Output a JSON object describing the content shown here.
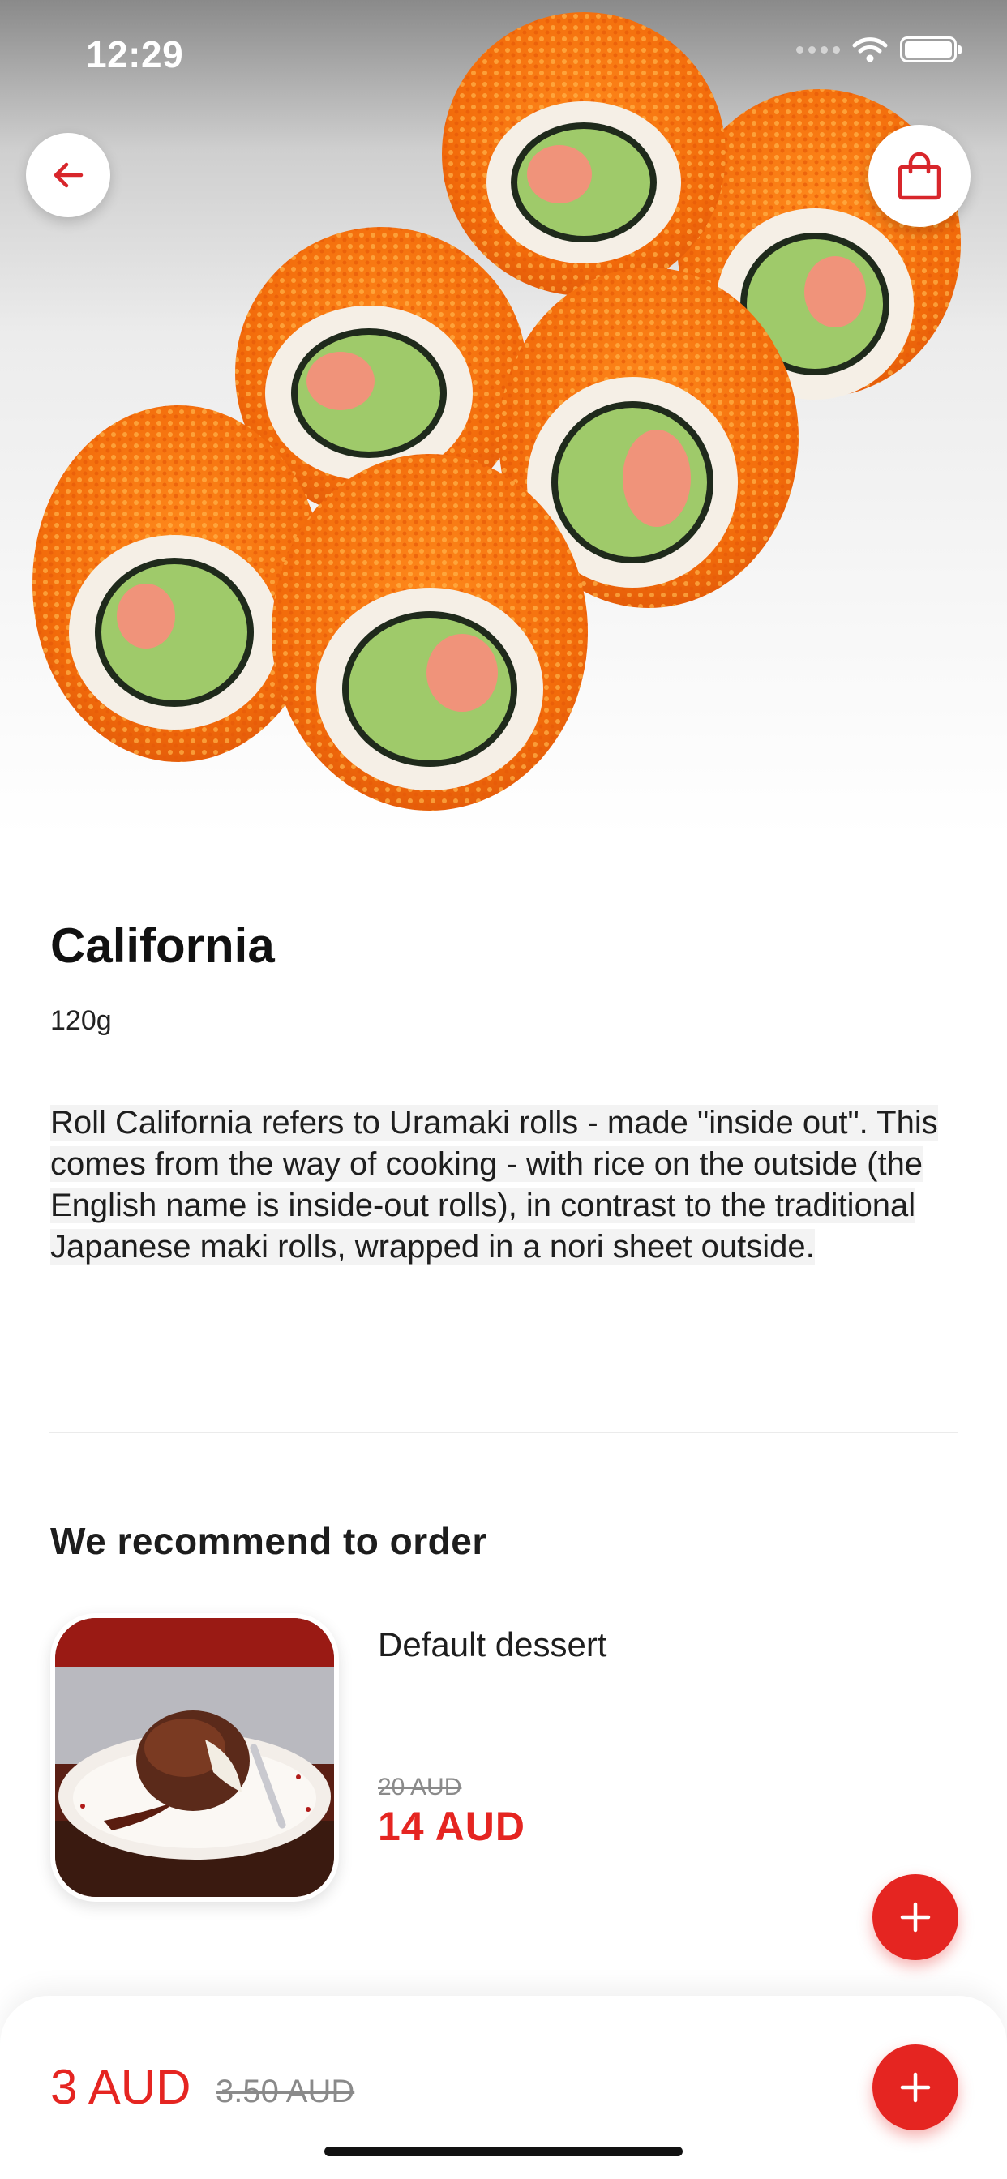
{
  "status_bar": {
    "time": "12:29"
  },
  "hero": {
    "image": "california-sushi-rolls-photo"
  },
  "icons": {
    "back": "arrow-left-icon",
    "cart": "shopping-bag-icon",
    "add": "plus-icon"
  },
  "product": {
    "title": "California",
    "weight": "120g",
    "description": "Roll California refers to Uramaki rolls - made \"inside out\". This comes from the way of cooking - with rice on the outside (the English name is inside-out rolls), in contrast to the traditional Japanese maki rolls, wrapped in a nori sheet outside."
  },
  "recommend": {
    "title": "We recommend to order",
    "items": [
      {
        "name": "Default dessert",
        "old_price": "20 AUD",
        "price": "14 AUD",
        "image": "chocolate-lava-cake-photo"
      }
    ]
  },
  "bottom_bar": {
    "price": "3 AUD",
    "old_price": "3.50 AUD"
  },
  "colors": {
    "accent": "#e52521",
    "text": "#141414",
    "muted": "#8a8a8a"
  }
}
